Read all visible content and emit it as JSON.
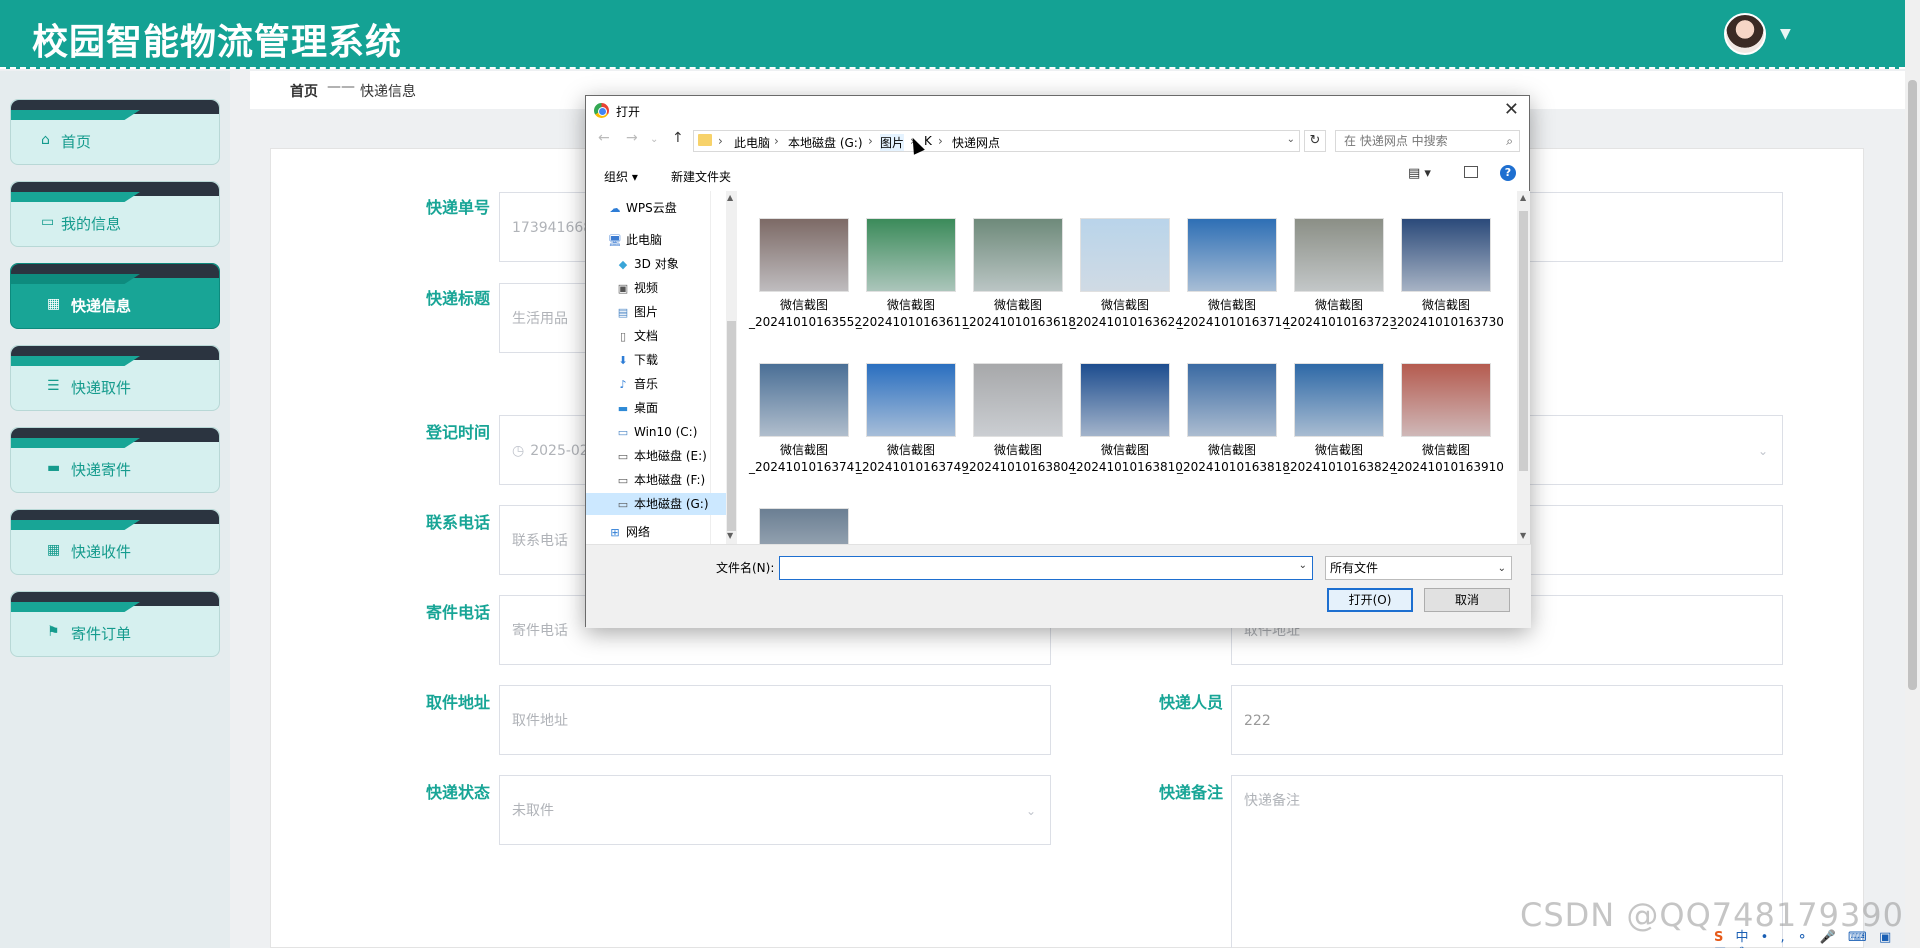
{
  "header": {
    "title": "校园智能物流管理系统"
  },
  "sidebar": {
    "items": [
      {
        "label": "首页",
        "icon": "home-icon",
        "glyph": "⌂"
      },
      {
        "label": "我的信息",
        "icon": "card-icon",
        "glyph": "▭"
      },
      {
        "label": "快递信息",
        "icon": "grid-icon",
        "glyph": "▦"
      },
      {
        "label": "快递取件",
        "icon": "list-icon",
        "glyph": "☰"
      },
      {
        "label": "快递寄件",
        "icon": "monitor-icon",
        "glyph": "▬"
      },
      {
        "label": "快递收件",
        "icon": "grid-icon",
        "glyph": "▦"
      },
      {
        "label": "寄件订单",
        "icon": "flag-icon",
        "glyph": "⚑"
      }
    ]
  },
  "breadcrumb": {
    "home": "首页",
    "sep": "——",
    "current": "快递信息"
  },
  "form": {
    "tracking_no_label": "快递单号",
    "tracking_no_value": "1739416684",
    "title_label": "快递标题",
    "title_value": "生活用品",
    "reg_time_label": "登记时间",
    "reg_time_value": "2025-02-",
    "contact_phone_label": "联系电话",
    "contact_phone_placeholder": "联系电话",
    "sender_phone_label": "寄件电话",
    "sender_phone_placeholder": "寄件电话",
    "sender_addr_placeholder": "取件地址",
    "pickup_addr_label": "取件地址",
    "pickup_addr_placeholder": "取件地址",
    "courier_label": "快递人员",
    "courier_value": "222",
    "status_label": "快递状态",
    "status_value": "未取件",
    "remark_label": "快递备注",
    "remark_placeholder": "快递备注"
  },
  "dialog": {
    "title": "打开",
    "address": [
      "此电脑",
      "本地磁盘 (G:)",
      "图片",
      "K",
      "快递网点"
    ],
    "search_placeholder": "在 快递网点 中搜索",
    "toolbar": {
      "organize": "组织 ▾",
      "new_folder": "新建文件夹"
    },
    "nav": [
      {
        "label": "WPS云盘",
        "icon": "cloud-icon",
        "glyph": "☁"
      },
      {
        "label": "此电脑",
        "icon": "computer-icon",
        "glyph": "🖥"
      },
      {
        "label": "3D 对象",
        "icon": "cube-icon",
        "glyph": "◆"
      },
      {
        "label": "视频",
        "icon": "video-icon",
        "glyph": "▣"
      },
      {
        "label": "图片",
        "icon": "picture-icon",
        "glyph": "▤"
      },
      {
        "label": "文档",
        "icon": "document-icon",
        "glyph": "▯"
      },
      {
        "label": "下载",
        "icon": "download-icon",
        "glyph": "⬇"
      },
      {
        "label": "音乐",
        "icon": "music-icon",
        "glyph": "♪"
      },
      {
        "label": "桌面",
        "icon": "desktop-icon",
        "glyph": "▬"
      },
      {
        "label": "Win10 (C:)",
        "icon": "drive-icon",
        "glyph": "▭"
      },
      {
        "label": "本地磁盘 (E:)",
        "icon": "drive-icon",
        "glyph": "▭"
      },
      {
        "label": "本地磁盘 (F:)",
        "icon": "drive-icon",
        "glyph": "▭"
      },
      {
        "label": "本地磁盘 (G:)",
        "icon": "drive-icon",
        "glyph": "▭"
      },
      {
        "label": "网络",
        "icon": "network-icon",
        "glyph": "⊞"
      }
    ],
    "files": [
      {
        "name": "微信截图_20241010163552",
        "color": "#7d6a66"
      },
      {
        "name": "微信截图_20241010163611",
        "color": "#3b8b5a"
      },
      {
        "name": "微信截图_20241010163618",
        "color": "#6e8a7a"
      },
      {
        "name": "微信截图_20241010163624",
        "color": "#b9d4ea"
      },
      {
        "name": "微信截图_20241010163714",
        "color": "#2e6fb5"
      },
      {
        "name": "微信截图_20241010163723",
        "color": "#8b8f86"
      },
      {
        "name": "微信截图_20241010163730",
        "color": "#2b4a7a"
      },
      {
        "name": "微信截图_20241010163741",
        "color": "#4a6f96"
      },
      {
        "name": "微信截图_20241010163749",
        "color": "#2a6fc0"
      },
      {
        "name": "微信截图_20241010163804",
        "color": "#a7a8aa"
      },
      {
        "name": "微信截图_20241010163810",
        "color": "#1d4d8f"
      },
      {
        "name": "微信截图_20241010163818",
        "color": "#3a6aa3"
      },
      {
        "name": "微信截图_20241010163824",
        "color": "#2e69a7"
      },
      {
        "name": "微信截图_20241010163910",
        "color": "#b55b4f"
      },
      {
        "name": "",
        "color": "#6b7f93"
      }
    ],
    "filename_label": "文件名(N):",
    "filetype": "所有文件",
    "open_btn": "打开(O)",
    "cancel_btn": "取消"
  },
  "watermark": "CSDN @QQ748179390",
  "ime": "中 • , ⚬ 🎤 ⌨ ▣ ▦ ✎"
}
